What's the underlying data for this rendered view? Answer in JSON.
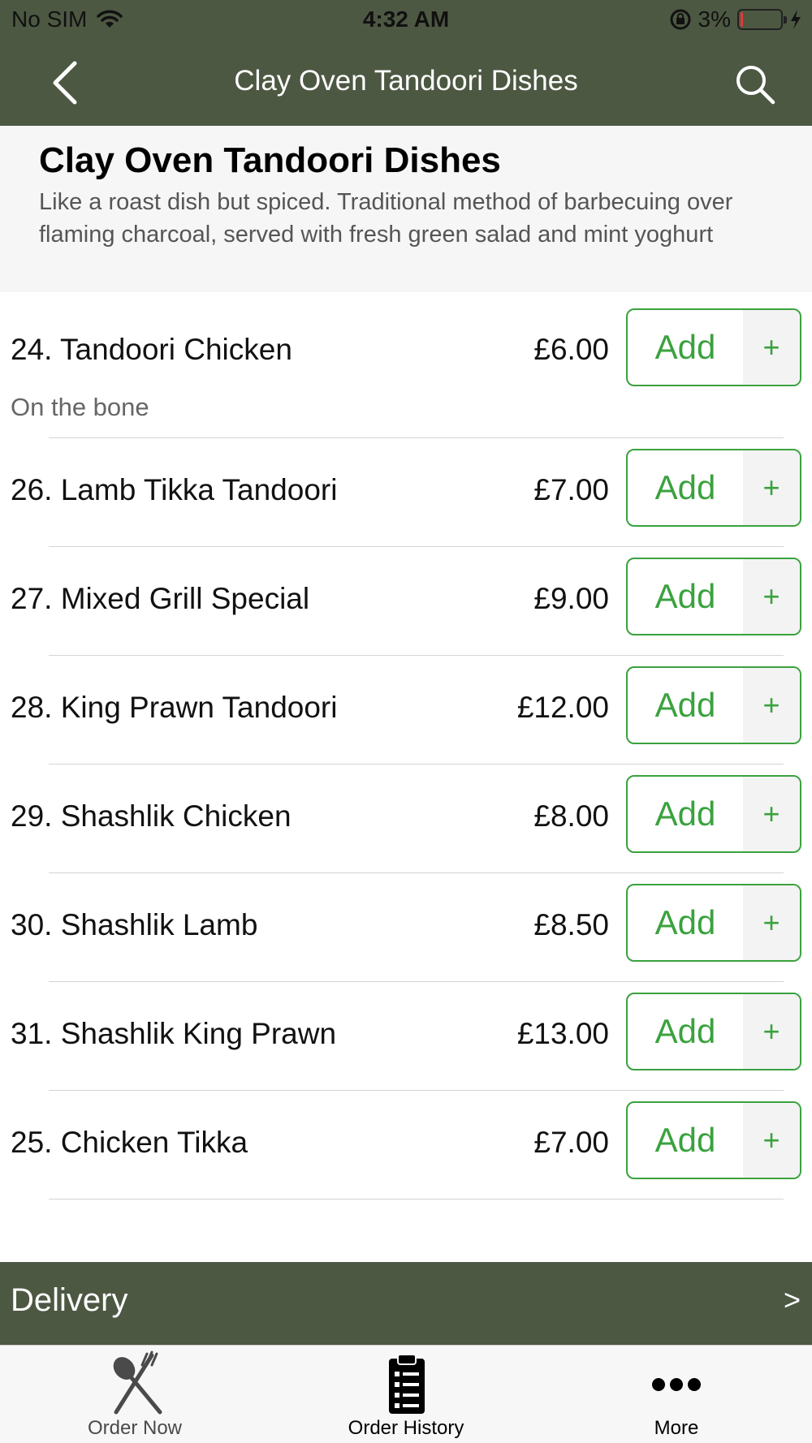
{
  "status_bar": {
    "carrier": "No SIM",
    "time": "4:32 AM",
    "battery_percent": "3%",
    "battery_level": 0.03,
    "battery_color": "#e53935"
  },
  "nav": {
    "title": "Clay Oven Tandoori Dishes",
    "back_icon": "chevron-left-icon",
    "search_icon": "search-icon"
  },
  "category": {
    "title": "Clay Oven Tandoori Dishes",
    "description": " Like a roast dish but spiced. Traditional method of barbecuing over flaming charcoal, served with fresh green salad and mint yoghurt"
  },
  "add_button": {
    "label": "Add",
    "plus": "+"
  },
  "menu_items": [
    {
      "name": "24. Tandoori Chicken",
      "price": "£6.00",
      "description": "On the bone"
    },
    {
      "name": "26. Lamb Tikka Tandoori",
      "price": "£7.00"
    },
    {
      "name": "27. Mixed Grill Special",
      "price": "£9.00"
    },
    {
      "name": "28. King Prawn Tandoori",
      "price": "£12.00"
    },
    {
      "name": "29. Shashlik Chicken",
      "price": "£8.00"
    },
    {
      "name": "30. Shashlik Lamb",
      "price": "£8.50"
    },
    {
      "name": "31. Shashlik King Prawn",
      "price": "£13.00"
    },
    {
      "name": "25. Chicken Tikka",
      "price": "£7.00"
    }
  ],
  "delivery": {
    "label": "Delivery",
    "arrow": ">"
  },
  "tabs": [
    {
      "label": "Order Now",
      "icon": "fork-spoon-icon",
      "active": false
    },
    {
      "label": "Order History",
      "icon": "clipboard-list-icon",
      "active": true
    },
    {
      "label": "More",
      "icon": "more-dots-icon",
      "active": false
    }
  ],
  "colors": {
    "header_bg": "#4d5843",
    "accent_green": "#3aa23e",
    "tab_inactive": "#4a4a4a",
    "tab_active": "#000000"
  }
}
